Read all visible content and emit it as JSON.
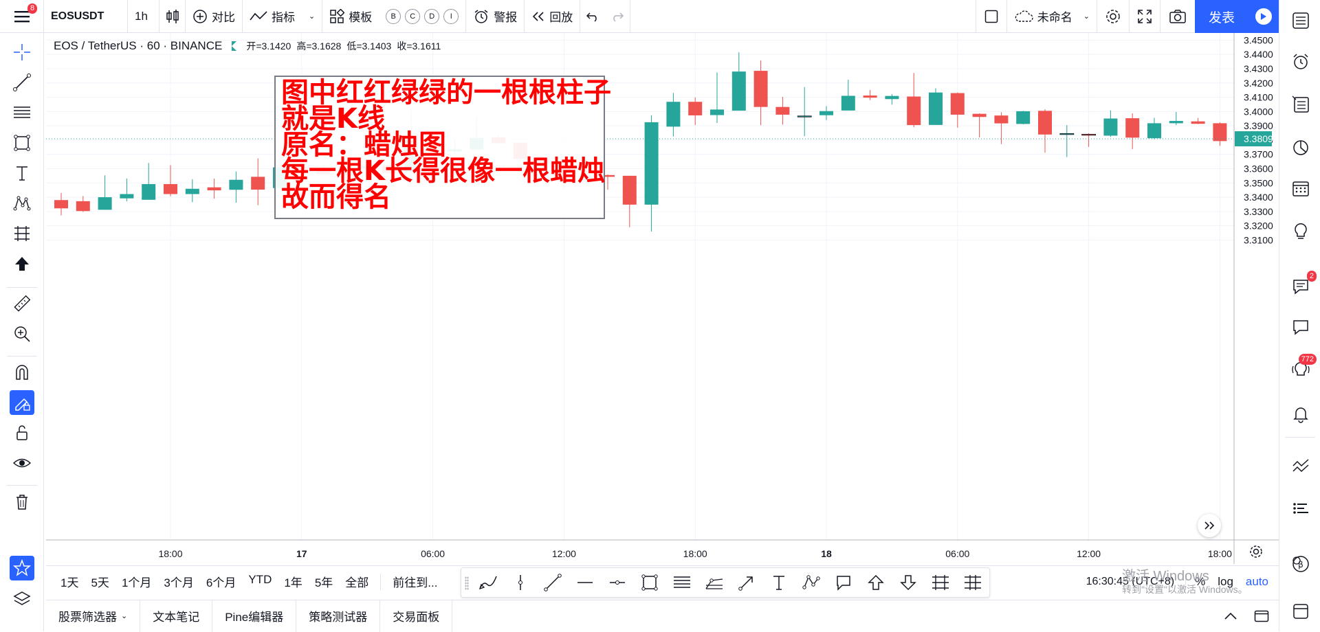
{
  "topbar": {
    "menu_badge": "8",
    "symbol": "EOSUSDT",
    "interval": "1h",
    "compare_label": "对比",
    "indicators_label": "指标",
    "templates_label": "模板",
    "quick_intervals": [
      "B",
      "C",
      "D",
      "I"
    ],
    "alert_label": "警报",
    "replay_label": "回放",
    "layout_name": "未命名",
    "publish_label": "发表"
  },
  "legend": {
    "title": "EOS / TetherUS · 60 · BINANCE",
    "open": "开=3.1420",
    "high": "高=3.1628",
    "low": "低=3.1403",
    "close": "收=3.1611"
  },
  "annotation": {
    "text": "图中红红绿绿的一根根柱子\n就是K线\n原名：蜡烛图\n每一根K长得很像一根蜡烛\n故而得名"
  },
  "colors": {
    "up": "#26a69a",
    "down": "#ef5350",
    "accent": "#2962ff",
    "price_tag": "#26a69a"
  },
  "chart_data": {
    "type": "candlestick",
    "symbol": "EOS / TetherUS",
    "ylim": [
      3.1,
      3.455
    ],
    "y_ticks": [
      "3.4500",
      "3.4400",
      "3.4300",
      "3.4200",
      "3.4100",
      "3.4000",
      "3.3900",
      "3.3800",
      "3.3700",
      "3.3600",
      "3.3500",
      "3.3400",
      "3.3300",
      "3.3200",
      "3.3100"
    ],
    "current_price": "3.3809",
    "x_tick_labels": [
      {
        "label": "18:00",
        "index": 5
      },
      {
        "label": "17",
        "index": 11
      },
      {
        "label": "06:00",
        "index": 17
      },
      {
        "label": "12:00",
        "index": 23
      },
      {
        "label": "18:00",
        "index": 29
      },
      {
        "label": "18",
        "index": 35
      },
      {
        "label": "06:00",
        "index": 41
      },
      {
        "label": "12:00",
        "index": 47
      },
      {
        "label": "18:00",
        "index": 53
      }
    ],
    "candles": [
      [
        3.338,
        3.343,
        3.3272,
        3.3322
      ],
      [
        3.3372,
        3.3408,
        3.3297,
        3.3303
      ],
      [
        3.3312,
        3.3553,
        3.3312,
        3.34
      ],
      [
        3.3392,
        3.3531,
        3.3371,
        3.3422
      ],
      [
        3.3382,
        3.364,
        3.3382,
        3.3492
      ],
      [
        3.3492,
        3.3624,
        3.3406,
        3.3422
      ],
      [
        3.3422,
        3.3526,
        3.3365,
        3.3459
      ],
      [
        3.3469,
        3.353,
        3.339,
        3.3448
      ],
      [
        3.3452,
        3.358,
        3.3362,
        3.3522
      ],
      [
        3.3543,
        3.3672,
        3.3344,
        3.3453
      ],
      [
        3.3464,
        3.3686,
        3.3464,
        3.3609
      ],
      [
        3.3613,
        3.3792,
        3.3594,
        3.3594
      ],
      [
        3.3593,
        3.363,
        3.3563,
        3.3563
      ],
      [
        3.3553,
        3.3625,
        3.3513,
        3.3617
      ],
      [
        3.36,
        3.362,
        3.3574,
        3.362
      ],
      [
        3.3624,
        3.364,
        3.3565,
        3.357
      ],
      [
        3.3575,
        3.4021,
        3.3575,
        3.3825
      ],
      [
        3.3824,
        3.3855,
        3.3716,
        3.3721
      ],
      [
        3.3721,
        3.38,
        3.37,
        3.3736
      ],
      [
        3.3734,
        3.396,
        3.3734,
        3.3815
      ],
      [
        3.3818,
        3.3833,
        3.3775,
        3.3778
      ],
      [
        3.3781,
        3.3784,
        3.3651,
        3.3669
      ],
      [
        3.3669,
        3.3684,
        3.362,
        3.3632
      ],
      [
        3.3651,
        3.3664,
        3.3454,
        3.3512
      ],
      [
        3.3512,
        3.3601,
        3.3504,
        3.3546
      ],
      [
        3.3555,
        3.356,
        3.3452,
        3.3543
      ],
      [
        3.355,
        3.355,
        3.319,
        3.3348
      ],
      [
        3.3348,
        3.3974,
        3.316,
        3.3925
      ],
      [
        3.3894,
        3.413,
        3.3825,
        3.4068
      ],
      [
        3.4068,
        3.4099,
        3.3905,
        3.3973
      ],
      [
        3.3975,
        3.4274,
        3.392,
        3.4014
      ],
      [
        3.4006,
        3.4414,
        3.4006,
        3.428
      ],
      [
        3.4285,
        3.4358,
        3.3904,
        3.4032
      ],
      [
        3.4032,
        3.4103,
        3.3908,
        3.3978
      ],
      [
        3.3969,
        3.4171,
        3.3827,
        3.3969
      ],
      [
        3.3974,
        3.4038,
        3.394,
        3.4003
      ],
      [
        3.4007,
        3.4223,
        3.4007,
        3.411
      ],
      [
        3.4112,
        3.415,
        3.408,
        3.4097
      ],
      [
        3.4087,
        3.4122,
        3.4048,
        3.4109
      ],
      [
        3.4105,
        3.427,
        3.3891,
        3.3905
      ],
      [
        3.3906,
        3.4163,
        3.3906,
        3.4133
      ],
      [
        3.4129,
        3.4133,
        3.3887,
        3.3978
      ],
      [
        3.3984,
        3.3987,
        3.3819,
        3.3962
      ],
      [
        3.3972,
        3.3995,
        3.3772,
        3.3917
      ],
      [
        3.3913,
        3.4005,
        3.391,
        3.4002
      ],
      [
        3.4005,
        3.4016,
        3.3712,
        3.3839
      ],
      [
        3.3846,
        3.3905,
        3.3681,
        3.3846
      ],
      [
        3.3841,
        3.3848,
        3.3752,
        3.384
      ],
      [
        3.3831,
        3.4008,
        3.3822,
        3.3951
      ],
      [
        3.3953,
        3.3987,
        3.3737,
        3.3817
      ],
      [
        3.3813,
        3.3956,
        3.3807,
        3.3918
      ],
      [
        3.3918,
        3.3997,
        3.3905,
        3.3934
      ],
      [
        3.3931,
        3.3955,
        3.3912,
        3.3914
      ],
      [
        3.3918,
        3.3924,
        3.3759,
        3.3793
      ]
    ]
  },
  "time_axis_gear": "gear-icon",
  "bottom": {
    "ranges": [
      "1天",
      "5天",
      "1个月",
      "3个月",
      "6个月",
      "YTD",
      "1年",
      "5年",
      "全部"
    ],
    "goto": "前往到...",
    "clock": "16:30:45 (UTC+8)",
    "percent": "%",
    "log": "log",
    "auto": "auto"
  },
  "panels": {
    "items": [
      "股票筛选器",
      "文本笔记",
      "Pine编辑器",
      "策略测试器",
      "交易面板"
    ]
  },
  "watermark": {
    "line1": "激活 Windows",
    "line2": "转到\"设置\"以激活 Windows。"
  },
  "right_badges": {
    "chat": "2",
    "ideas": "772"
  }
}
